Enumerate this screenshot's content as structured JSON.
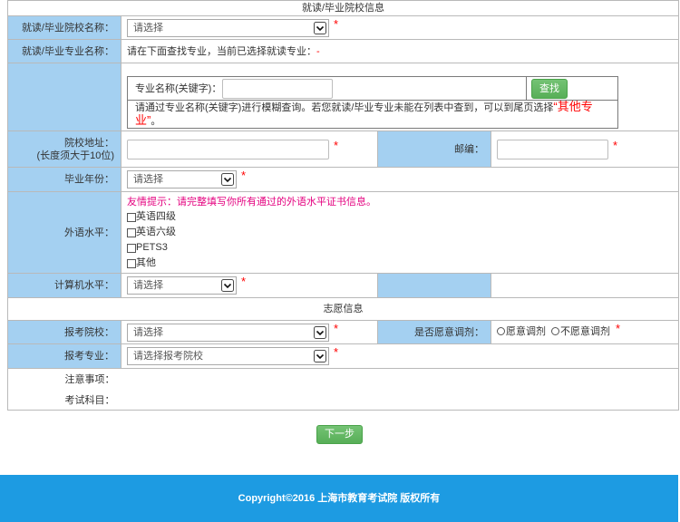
{
  "sections": {
    "school_info_title": "就读/毕业院校信息",
    "preference_title": "志愿信息"
  },
  "form": {
    "school_name": {
      "label": "就读/毕业院校名称：",
      "value": "请选择",
      "required": "*"
    },
    "major_name": {
      "label": "就读/毕业专业名称：",
      "text": "请在下面查找专业，当前已选择就读专业：",
      "selected": "-"
    },
    "major_search": {
      "keyword_label": "专业名称(关键字)：",
      "keyword_value": "",
      "search_button": "查找",
      "hint": "请通过专业名称(关键字)进行模糊查询。若您就读/毕业专业未能在列表中查到，可以到尾页选择",
      "hint_highlight": "“其他专业”",
      "hint_end": "。"
    },
    "school_address": {
      "label_line1": "院校地址：",
      "label_line2": "(长度须大于10位)",
      "value": "",
      "required": "*"
    },
    "postcode": {
      "label": "邮编：",
      "value": "",
      "required": "*"
    },
    "graduation_year": {
      "label": "毕业年份：",
      "value": "请选择",
      "required": "*"
    },
    "foreign_language": {
      "label": "外语水平：",
      "tip": "友情提示：请完整填写你所有通过的外语水平证书信息。",
      "options": [
        {
          "label": "英语四级",
          "checked": false
        },
        {
          "label": "英语六级",
          "checked": false
        },
        {
          "label": "PETS3",
          "checked": false
        },
        {
          "label": "其他",
          "checked": false
        }
      ]
    },
    "computer_level": {
      "label": "计算机水平：",
      "value": "请选择",
      "required": "*"
    },
    "apply_school": {
      "label": "报考院校：",
      "value": "请选择",
      "required": "*"
    },
    "adjustment": {
      "label": "是否愿意调剂：",
      "options": [
        {
          "label": "愿意调剂",
          "selected": false
        },
        {
          "label": "不愿意调剂",
          "selected": false
        }
      ],
      "required": "*"
    },
    "apply_major": {
      "label": "报考专业：",
      "value": "请选择报考院校",
      "required": "*"
    },
    "notes_label": "注意事项：",
    "exam_subjects_label": "考试科目："
  },
  "actions": {
    "next_button": "下一步"
  },
  "footer": {
    "copyright": "Copyright©2016 上海市教育考试院 版权所有"
  },
  "icons": {
    "select_arrow": "chevron-down-icon"
  },
  "colors": {
    "label_bg": "#a4d0f1",
    "border": "#b9b9b9",
    "required": "#ff0000",
    "tip": "#e4007f",
    "button_green": "#5cb85c",
    "footer_bg": "#1d9be2",
    "highlight": "#ff0000"
  }
}
